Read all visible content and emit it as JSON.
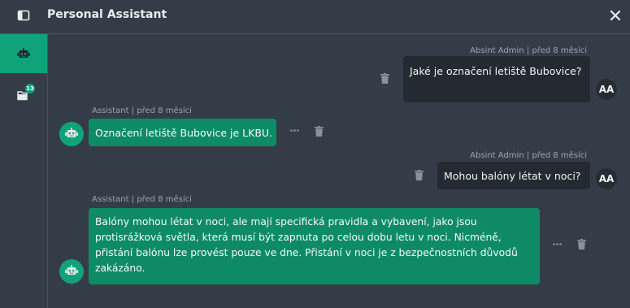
{
  "header": {
    "title": "Personal Assistant",
    "panel_icon": "sidebar-panel-icon",
    "close_icon": "close-icon"
  },
  "sidebar": {
    "tabs": [
      {
        "icon": "robot-icon",
        "active": true
      },
      {
        "icon": "folder-icon",
        "badge": "13"
      }
    ]
  },
  "colors": {
    "accent": "#10a37a",
    "bot_bubble": "#0f8a66",
    "user_bubble": "#232a31",
    "background": "#343d47"
  },
  "messages": [
    {
      "role": "user",
      "meta": "Absint Admin | před 8 měsíci",
      "text": "Jaké je označení letiště Bubovice?",
      "avatar": "AA"
    },
    {
      "role": "bot",
      "meta": "Assistant | před 8 měsíci",
      "text": "Označení letiště Bubovice je LKBU."
    },
    {
      "role": "user",
      "meta": "Absint Admin | před 8 měsíci",
      "text": "Mohou balóny létat v noci?",
      "avatar": "AA"
    },
    {
      "role": "bot",
      "meta": "Assistant | před 8 měsíci",
      "text": "Balóny mohou létat v noci, ale mají specifická pravidla a vybavení, jako jsou protisrážková světla, která musí být zapnuta po celou dobu letu v noci. Nicméně, přistání balónu lze provést pouze ve dne. Přistání v noci je z bezpečnostních důvodů zakázáno."
    }
  ]
}
